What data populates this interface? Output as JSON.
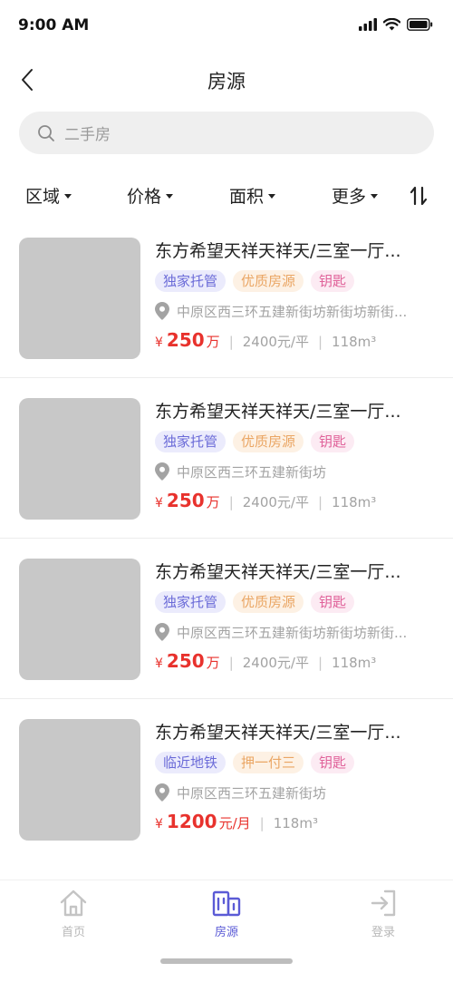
{
  "status": {
    "time": "9:00 AM"
  },
  "nav": {
    "title": "房源"
  },
  "search": {
    "placeholder": "二手房"
  },
  "filters": [
    {
      "label": "区域"
    },
    {
      "label": "价格"
    },
    {
      "label": "面积"
    },
    {
      "label": "更多"
    }
  ],
  "listings": [
    {
      "title": "东方希望天祥天祥天/三室一厅...",
      "tags": [
        "独家托管",
        "优质房源",
        "钥匙"
      ],
      "address": "中原区西三环五建新街坊新街坊新街...",
      "price_symbol": "¥",
      "price": "250",
      "price_unit": "万",
      "unit_price": "2400元/平",
      "area": "118m³"
    },
    {
      "title": "东方希望天祥天祥天/三室一厅...",
      "tags": [
        "独家托管",
        "优质房源",
        "钥匙"
      ],
      "address": "中原区西三环五建新街坊",
      "price_symbol": "¥",
      "price": "250",
      "price_unit": "万",
      "unit_price": "2400元/平",
      "area": "118m³"
    },
    {
      "title": "东方希望天祥天祥天/三室一厅...",
      "tags": [
        "独家托管",
        "优质房源",
        "钥匙"
      ],
      "address": "中原区西三环五建新街坊新街坊新街...",
      "price_symbol": "¥",
      "price": "250",
      "price_unit": "万",
      "unit_price": "2400元/平",
      "area": "118m³"
    },
    {
      "title": "东方希望天祥天祥天/三室一厅...",
      "tags": [
        "临近地铁",
        "押一付三",
        "钥匙"
      ],
      "address": "中原区西三环五建新街坊",
      "price_symbol": "¥",
      "price": "1200",
      "price_unit": "元/月",
      "unit_price": "",
      "area": "118m³"
    }
  ],
  "tab_bar": {
    "tabs": [
      {
        "label": "首页",
        "icon": "home-icon",
        "active": false
      },
      {
        "label": "房源",
        "icon": "building-icon",
        "active": true
      },
      {
        "label": "登录",
        "icon": "login-icon",
        "active": false
      }
    ]
  },
  "colors": {
    "accent": "#5b5bd6",
    "price": "#e8322d",
    "tag_blue_bg": "#ebebfc",
    "tag_blue_fg": "#6b6bd8",
    "tag_orange_bg": "#fdf1e4",
    "tag_orange_fg": "#eaa664",
    "tag_pink_bg": "#fcebf3",
    "tag_pink_fg": "#e0629a"
  }
}
